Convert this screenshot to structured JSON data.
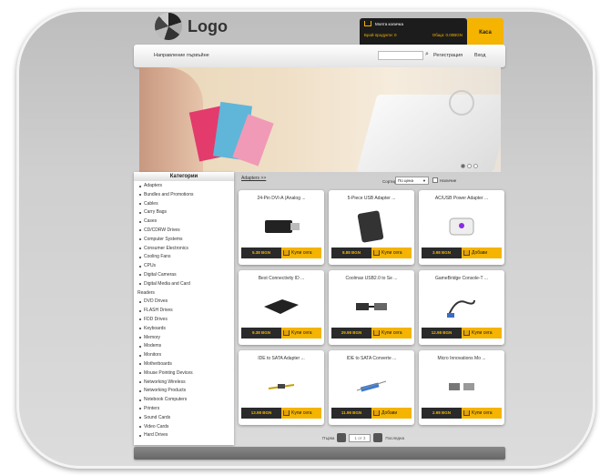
{
  "header": {
    "logo_text": "Logo",
    "cart_title": "Моята количка",
    "cart_items": "Брой продукти: 0",
    "cart_total": "Обща: 0.00ВGN",
    "kasa_label": "Каса"
  },
  "topbar": {
    "home_label": "Направление първъйне",
    "search_value": "",
    "register_label": "Регистрация",
    "login_label": "Вход"
  },
  "sidebar": {
    "title": "Категории",
    "items": [
      "Adapters",
      "Bundles and Promotions",
      "Cables",
      "Carry Bags",
      "Cases",
      "CD/CDRW Drives",
      "Computer Systems",
      "Consumer Electronics",
      "Cooling Fans",
      "CPUs",
      "Digital Cameras",
      "Digital Media and Card",
      "Readers",
      "DVD Drives",
      "FLASH Drives",
      "FDD Drives",
      "Keyboards",
      "Memory",
      "Modems",
      "Monitors",
      "Motherboards",
      "Mouse Pointing Devices",
      "Networking Wireless",
      "Networking Products",
      "Notebook Computers",
      "Printers",
      "Sound Cards",
      "Video Cards",
      "Hard Drives"
    ]
  },
  "toolbar": {
    "breadcrumb": "Adapters >>",
    "sort_label": "Сортирай",
    "sort_value": "По цена",
    "checkbox_label": "Наличие"
  },
  "products": [
    {
      "title": "24-Pin DVI-A (Analog ...",
      "price": "5.38 BGN",
      "buy": "Kупи сега"
    },
    {
      "title": "5-Piece USB Adapter ...",
      "price": "8.88 BGN",
      "buy": "Kупи сега"
    },
    {
      "title": "AC/USB Power Adapter ...",
      "price": "3.98 BGN",
      "buy": "Добави"
    },
    {
      "title": "Best Connectivity ID ...",
      "price": "9.38 BGN",
      "buy": "Kупи сега"
    },
    {
      "title": "Coolmax USB2.0 to Se ...",
      "price": "29.98 BGN",
      "buy": "Kупи сега"
    },
    {
      "title": "GameBridge Console-T ...",
      "price": "12.98 BGN",
      "buy": "Kупи сега"
    },
    {
      "title": "IDE to SATA Adapter ...",
      "price": "13.98 BGN",
      "buy": "Kупи сега"
    },
    {
      "title": "IDE to SATA Converte ...",
      "price": "11.98 BGN",
      "buy": "Добави"
    },
    {
      "title": "Micro Innovations Mo ...",
      "price": "2.98 BGN",
      "buy": "Kупи сега"
    }
  ],
  "pager": {
    "prev_label": "Първа",
    "page_value": "1 от 3",
    "next_label": "Последна"
  },
  "colors": {
    "accent": "#f4b400",
    "dark": "#2a2a2a"
  }
}
